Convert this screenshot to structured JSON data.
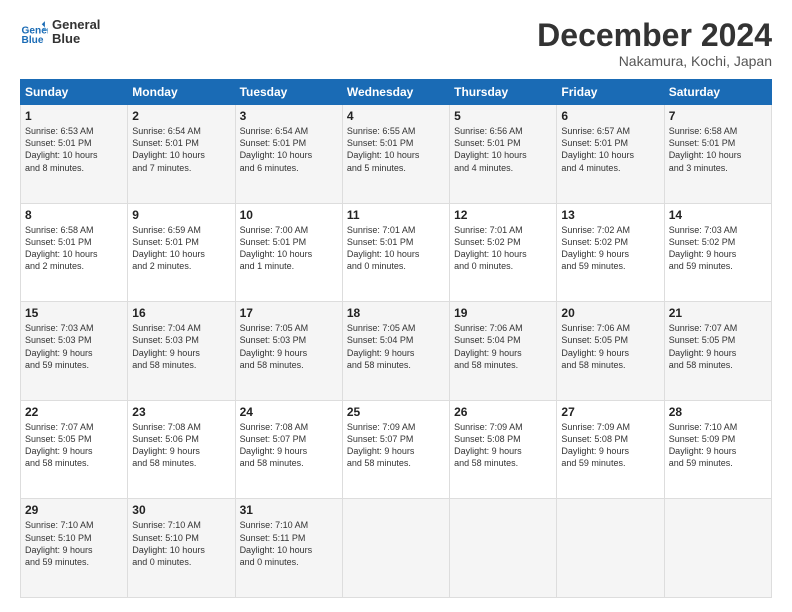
{
  "logo": {
    "line1": "General",
    "line2": "Blue"
  },
  "header": {
    "month": "December 2024",
    "location": "Nakamura, Kochi, Japan"
  },
  "weekdays": [
    "Sunday",
    "Monday",
    "Tuesday",
    "Wednesday",
    "Thursday",
    "Friday",
    "Saturday"
  ],
  "weeks": [
    [
      {
        "day": "1",
        "info": "Sunrise: 6:53 AM\nSunset: 5:01 PM\nDaylight: 10 hours\nand 8 minutes."
      },
      {
        "day": "2",
        "info": "Sunrise: 6:54 AM\nSunset: 5:01 PM\nDaylight: 10 hours\nand 7 minutes."
      },
      {
        "day": "3",
        "info": "Sunrise: 6:54 AM\nSunset: 5:01 PM\nDaylight: 10 hours\nand 6 minutes."
      },
      {
        "day": "4",
        "info": "Sunrise: 6:55 AM\nSunset: 5:01 PM\nDaylight: 10 hours\nand 5 minutes."
      },
      {
        "day": "5",
        "info": "Sunrise: 6:56 AM\nSunset: 5:01 PM\nDaylight: 10 hours\nand 4 minutes."
      },
      {
        "day": "6",
        "info": "Sunrise: 6:57 AM\nSunset: 5:01 PM\nDaylight: 10 hours\nand 4 minutes."
      },
      {
        "day": "7",
        "info": "Sunrise: 6:58 AM\nSunset: 5:01 PM\nDaylight: 10 hours\nand 3 minutes."
      }
    ],
    [
      {
        "day": "8",
        "info": "Sunrise: 6:58 AM\nSunset: 5:01 PM\nDaylight: 10 hours\nand 2 minutes."
      },
      {
        "day": "9",
        "info": "Sunrise: 6:59 AM\nSunset: 5:01 PM\nDaylight: 10 hours\nand 2 minutes."
      },
      {
        "day": "10",
        "info": "Sunrise: 7:00 AM\nSunset: 5:01 PM\nDaylight: 10 hours\nand 1 minute."
      },
      {
        "day": "11",
        "info": "Sunrise: 7:01 AM\nSunset: 5:01 PM\nDaylight: 10 hours\nand 0 minutes."
      },
      {
        "day": "12",
        "info": "Sunrise: 7:01 AM\nSunset: 5:02 PM\nDaylight: 10 hours\nand 0 minutes."
      },
      {
        "day": "13",
        "info": "Sunrise: 7:02 AM\nSunset: 5:02 PM\nDaylight: 9 hours\nand 59 minutes."
      },
      {
        "day": "14",
        "info": "Sunrise: 7:03 AM\nSunset: 5:02 PM\nDaylight: 9 hours\nand 59 minutes."
      }
    ],
    [
      {
        "day": "15",
        "info": "Sunrise: 7:03 AM\nSunset: 5:03 PM\nDaylight: 9 hours\nand 59 minutes."
      },
      {
        "day": "16",
        "info": "Sunrise: 7:04 AM\nSunset: 5:03 PM\nDaylight: 9 hours\nand 58 minutes."
      },
      {
        "day": "17",
        "info": "Sunrise: 7:05 AM\nSunset: 5:03 PM\nDaylight: 9 hours\nand 58 minutes."
      },
      {
        "day": "18",
        "info": "Sunrise: 7:05 AM\nSunset: 5:04 PM\nDaylight: 9 hours\nand 58 minutes."
      },
      {
        "day": "19",
        "info": "Sunrise: 7:06 AM\nSunset: 5:04 PM\nDaylight: 9 hours\nand 58 minutes."
      },
      {
        "day": "20",
        "info": "Sunrise: 7:06 AM\nSunset: 5:05 PM\nDaylight: 9 hours\nand 58 minutes."
      },
      {
        "day": "21",
        "info": "Sunrise: 7:07 AM\nSunset: 5:05 PM\nDaylight: 9 hours\nand 58 minutes."
      }
    ],
    [
      {
        "day": "22",
        "info": "Sunrise: 7:07 AM\nSunset: 5:05 PM\nDaylight: 9 hours\nand 58 minutes."
      },
      {
        "day": "23",
        "info": "Sunrise: 7:08 AM\nSunset: 5:06 PM\nDaylight: 9 hours\nand 58 minutes."
      },
      {
        "day": "24",
        "info": "Sunrise: 7:08 AM\nSunset: 5:07 PM\nDaylight: 9 hours\nand 58 minutes."
      },
      {
        "day": "25",
        "info": "Sunrise: 7:09 AM\nSunset: 5:07 PM\nDaylight: 9 hours\nand 58 minutes."
      },
      {
        "day": "26",
        "info": "Sunrise: 7:09 AM\nSunset: 5:08 PM\nDaylight: 9 hours\nand 58 minutes."
      },
      {
        "day": "27",
        "info": "Sunrise: 7:09 AM\nSunset: 5:08 PM\nDaylight: 9 hours\nand 59 minutes."
      },
      {
        "day": "28",
        "info": "Sunrise: 7:10 AM\nSunset: 5:09 PM\nDaylight: 9 hours\nand 59 minutes."
      }
    ],
    [
      {
        "day": "29",
        "info": "Sunrise: 7:10 AM\nSunset: 5:10 PM\nDaylight: 9 hours\nand 59 minutes."
      },
      {
        "day": "30",
        "info": "Sunrise: 7:10 AM\nSunset: 5:10 PM\nDaylight: 10 hours\nand 0 minutes."
      },
      {
        "day": "31",
        "info": "Sunrise: 7:10 AM\nSunset: 5:11 PM\nDaylight: 10 hours\nand 0 minutes."
      },
      null,
      null,
      null,
      null
    ]
  ]
}
